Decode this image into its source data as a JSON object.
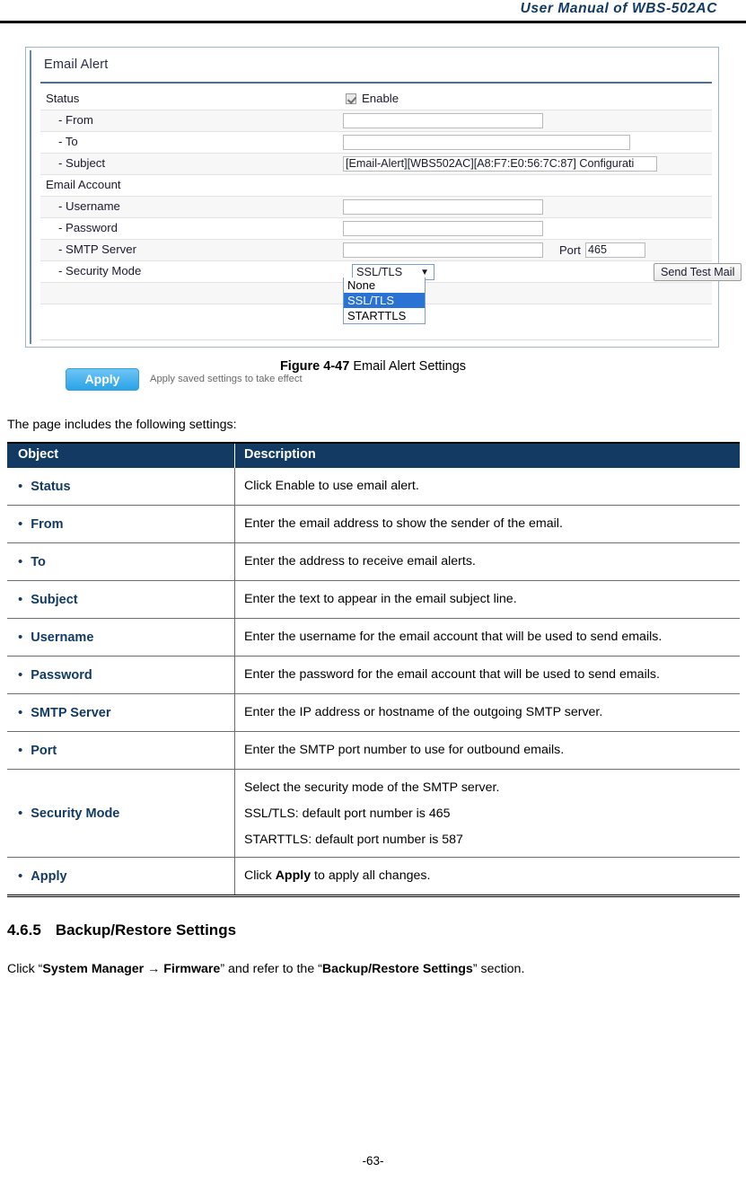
{
  "header": {
    "title": "User  Manual  of  WBS-502AC"
  },
  "footer": {
    "page_number": "-63-"
  },
  "ui_screenshot": {
    "panel_title": "Email Alert",
    "rows": {
      "status": {
        "label": "Status",
        "checkbox_label": "Enable",
        "checked": true
      },
      "from": {
        "label": "- From",
        "value": ""
      },
      "to": {
        "label": "- To",
        "value": ""
      },
      "subject": {
        "label": "- Subject",
        "value": "[Email-Alert][WBS502AC][A8:F7:E0:56:7C:87] Configurati"
      },
      "email_account": {
        "label": "Email Account"
      },
      "username": {
        "label": "- Username",
        "value": ""
      },
      "password": {
        "label": "- Password",
        "value": ""
      },
      "smtp_server": {
        "label": "- SMTP Server",
        "value": "",
        "port_label": "Port",
        "port_value": "465"
      },
      "security_mode": {
        "label": "- Security Mode",
        "selected": "SSL/TLS",
        "caret": "▼",
        "options": [
          "None",
          "SSL/TLS",
          "STARTTLS"
        ],
        "highlighted_option": "SSL/TLS"
      }
    },
    "buttons": {
      "send_test_mail": "Send Test Mail",
      "apply": "Apply",
      "apply_hint": "Apply saved settings to take effect"
    },
    "colors": {
      "panel_border": "#9fb4cf",
      "title_rule": "#4a6f9e",
      "apply_button": "#2aa3e8",
      "dropdown_highlight": "#2a72d4"
    }
  },
  "figure": {
    "label": "Figure 4-47",
    "caption": "Email Alert Settings"
  },
  "intro": {
    "text": "The page includes the following settings:"
  },
  "settings_table": {
    "headers": {
      "object": "Object",
      "description": "Description"
    },
    "header_bg": "#123A63",
    "rows": [
      {
        "object": "Status",
        "description": [
          "Click Enable to use email alert."
        ]
      },
      {
        "object": "From",
        "description": [
          "Enter the email address to show the sender of the email."
        ]
      },
      {
        "object": "To",
        "description": [
          "Enter the address to receive email alerts."
        ]
      },
      {
        "object": "Subject",
        "description": [
          "Enter the text to appear in the email subject line."
        ]
      },
      {
        "object": "Username",
        "description": [
          "Enter the username for the email account that will be used to send emails."
        ]
      },
      {
        "object": "Password",
        "description": [
          "Enter the password for the email account that will be used to send emails."
        ]
      },
      {
        "object": "SMTP Server",
        "description": [
          "Enter the IP address or hostname of the outgoing SMTP server."
        ]
      },
      {
        "object": "Port",
        "description": [
          "Enter the SMTP port number to use for outbound emails."
        ]
      },
      {
        "object": "Security Mode",
        "description": [
          "Select the security mode of the SMTP server.",
          "SSL/TLS: default port number is 465",
          "STARTTLS: default port number is 587"
        ]
      },
      {
        "object": "Apply",
        "description": [
          "Click Apply to apply all changes."
        ],
        "bold_word": "Apply"
      }
    ],
    "bullet": "•"
  },
  "section": {
    "number": "4.6.5",
    "title": "Backup/Restore Settings",
    "body_prefix": "Click “",
    "body_bold1": "System Manager → Firmware",
    "body_mid": "” and refer to the “",
    "body_bold2": "Backup/Restore Settings",
    "body_suffix": "” section."
  }
}
